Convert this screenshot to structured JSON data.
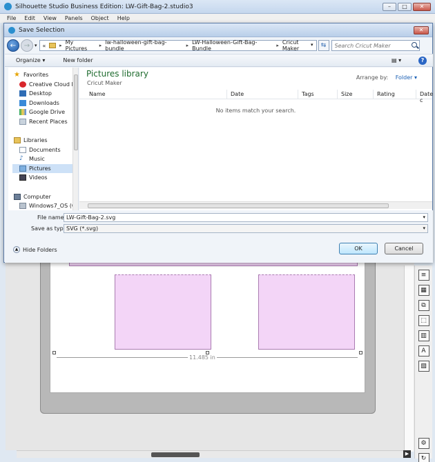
{
  "app": {
    "title": "Silhouette Studio Business Edition: LW-Gift-Bag-2.studio3",
    "menu": [
      "File",
      "Edit",
      "View",
      "Panels",
      "Object",
      "Help"
    ]
  },
  "canvas": {
    "measurement": "11.485 in"
  },
  "dialog": {
    "title": "Save Selection",
    "breadcrumb": [
      "My Pictures",
      "lw-halloween-gift-bag-bundle",
      "LW-Halloween-Gift-Bag-Bundle",
      "Cricut Maker"
    ],
    "breadcrumb_prefix": "«",
    "search_placeholder": "Search Cricut Maker",
    "toolbar": {
      "organize": "Organize ▾",
      "new_folder": "New folder",
      "view_icon": "▤ ▾",
      "help_icon": "?"
    },
    "nav": {
      "favorites_header": "Favorites",
      "favorites": [
        "Creative Cloud Fi",
        "Desktop",
        "Downloads",
        "Google Drive",
        "Recent Places"
      ],
      "libraries_header": "Libraries",
      "libraries": [
        "Documents",
        "Music",
        "Pictures",
        "Videos"
      ],
      "computer_header": "Computer",
      "computer": [
        "Windows7_OS (C"
      ]
    },
    "content": {
      "library_title": "Pictures library",
      "library_subtitle": "Cricut Maker",
      "arrange_label": "Arrange by:",
      "arrange_value": "Folder ▾",
      "columns": [
        "Name",
        "Date",
        "Tags",
        "Size",
        "Rating",
        "Date c"
      ],
      "empty_message": "No items match your search."
    },
    "form": {
      "file_name_label": "File name:",
      "file_name_value": "LW-Gift-Bag-2.svg",
      "save_type_label": "Save as type:",
      "save_type_value": "SVG (*.svg)"
    },
    "hide_folders": "Hide Folders",
    "ok_label": "OK",
    "cancel_label": "Cancel"
  },
  "colors": {
    "library_title": "#1e6b2e",
    "link_blue": "#1a5fb4",
    "piece_fill": "#f3d5f7",
    "selected_nav": "#cde1f7"
  }
}
